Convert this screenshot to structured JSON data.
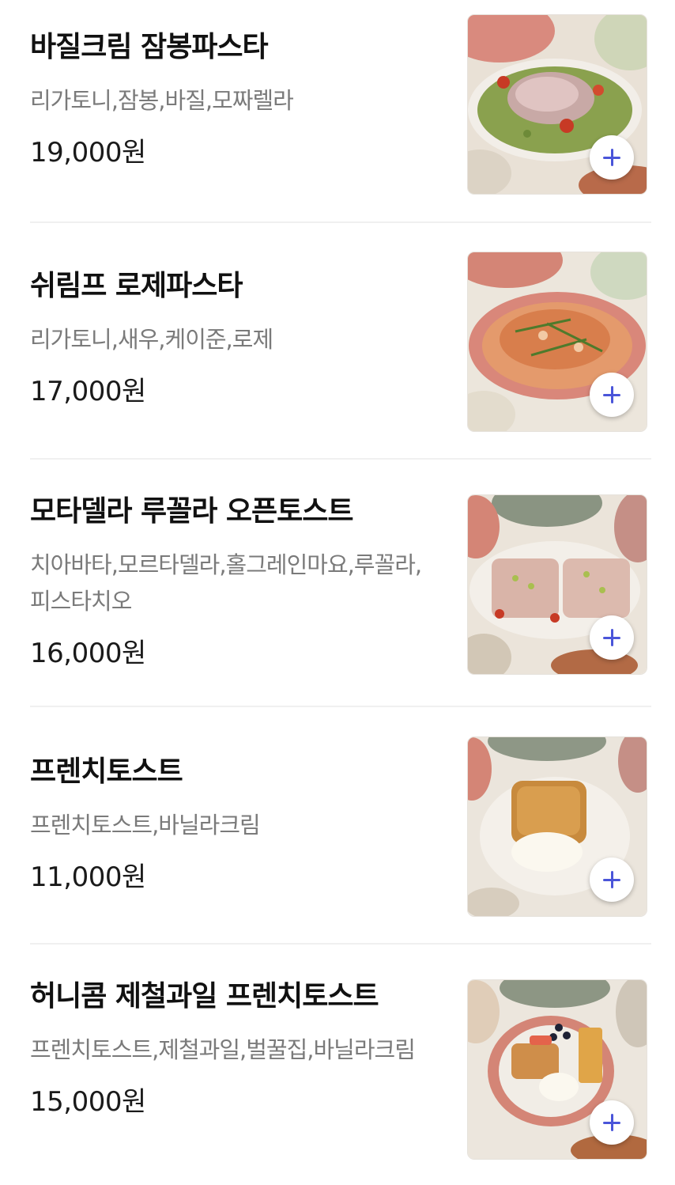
{
  "menu": {
    "items": [
      {
        "name": "바질크림 잠봉파스타",
        "description": "리가토니,잠봉,바질,모짜렐라",
        "price": "19,000원",
        "image": "basil-cream-pasta-photo"
      },
      {
        "name": "쉬림프 로제파스타",
        "description": "리가토니,새우,케이준,로제",
        "price": "17,000원",
        "image": "shrimp-rose-pasta-photo"
      },
      {
        "name": "모타델라 루꼴라 오픈토스트",
        "description": "치아바타,모르타델라,홀그레인마요,루꼴라,피스타치오",
        "price": "16,000원",
        "image": "mortadella-open-toast-photo"
      },
      {
        "name": "프렌치토스트",
        "description": "프렌치토스트,바닐라크림",
        "price": "11,000원",
        "image": "french-toast-photo"
      },
      {
        "name": "허니콤 제철과일 프렌치토스트",
        "description": "프렌치토스트,제철과일,벌꿀집,바닐라크림",
        "price": "15,000원",
        "image": "honeycomb-fruit-french-toast-photo"
      }
    ],
    "add_icon": "plus-icon",
    "accent_color": "#4a55d9"
  }
}
